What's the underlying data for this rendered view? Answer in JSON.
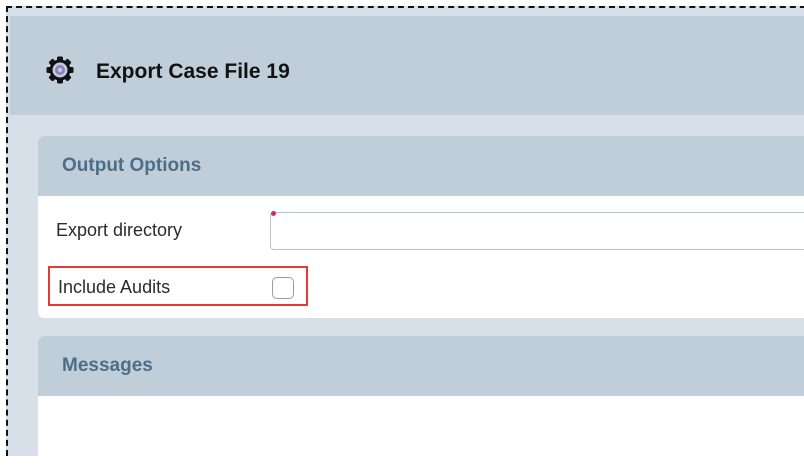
{
  "dialog": {
    "title": "Export Case File 19",
    "icon": "gear-icon"
  },
  "output_options": {
    "heading": "Output Options",
    "export_directory": {
      "label": "Export directory",
      "value": "",
      "required": true
    },
    "include_audits": {
      "label": "Include Audits",
      "checked": false
    }
  },
  "messages": {
    "heading": "Messages"
  },
  "colors": {
    "header_bg": "#c0ceda",
    "panel_heading_text": "#4e6e88",
    "highlight": "#e53935",
    "required_marker": "#e0245e"
  }
}
